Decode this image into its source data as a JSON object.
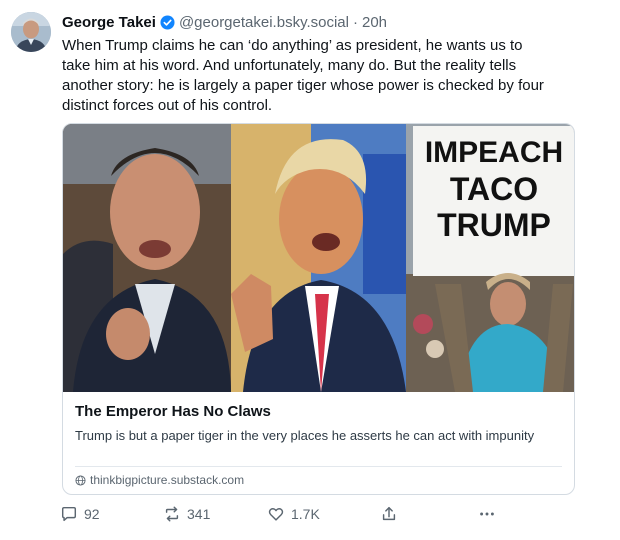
{
  "author": {
    "name": "George Takei",
    "handle": "@georgetakei.bsky.social",
    "separator": "·",
    "time": "20h"
  },
  "post": {
    "text": "When Trump claims he can ‘do anything’ as president, he wants us to\ntake him at his word. And unfortunately, many do. But the reality tells\nanother story: he is largely a paper tiger whose power is checked by four\ndistinct forces out of his control."
  },
  "embed": {
    "sign_lines": [
      "IMPEACH",
      "TACO",
      "TRUMP"
    ],
    "title": "The Emperor Has No Claws",
    "description": "Trump is but a paper tiger in the very places he asserts he can act with impunity",
    "domain": "thinkbigpicture.substack.com"
  },
  "actions": {
    "replies": "92",
    "reposts": "341",
    "likes": "1.7K"
  },
  "icons": {
    "verified": "verified-badge-icon",
    "reply": "speech-bubble-icon",
    "repost": "repost-arrows-icon",
    "like": "heart-icon",
    "share": "share-upload-icon",
    "more": "ellipsis-icon",
    "domain": "globe-icon"
  },
  "colors": {
    "verified_blue": "#1185fe",
    "text_secondary": "#5b6670",
    "border": "#d4dbe2"
  }
}
